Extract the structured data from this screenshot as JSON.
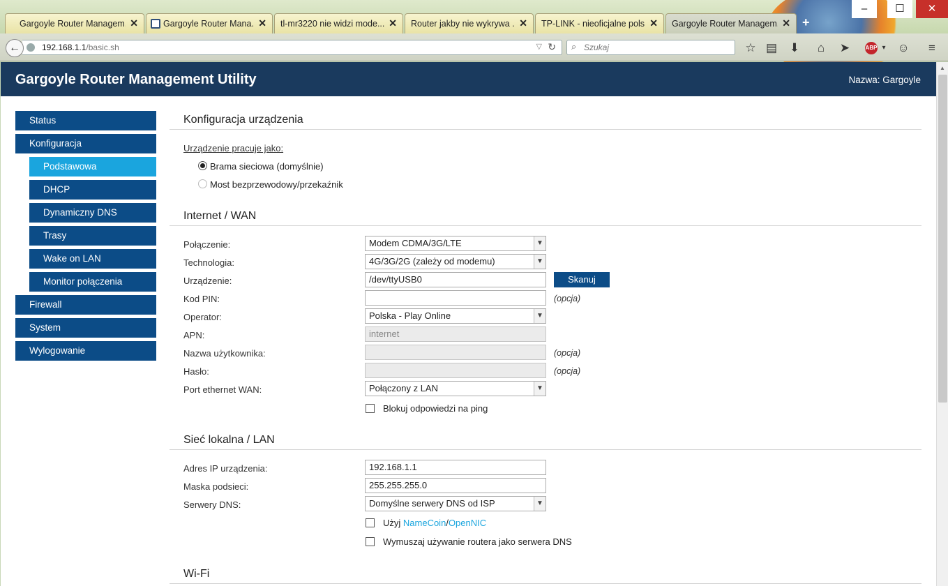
{
  "browser": {
    "tabs": [
      {
        "title": "Gargoyle Router Managem..."
      },
      {
        "title": "Gargoyle Router Mana..."
      },
      {
        "title": "tl-mr3220 nie widzi mode..."
      },
      {
        "title": "Router jakby nie wykrywa ..."
      },
      {
        "title": "TP-LINK - nieoficjalne pols..."
      },
      {
        "title": "Gargoyle Router Managem..."
      }
    ],
    "url_host": "192.168.1.1",
    "url_path": "/basic.sh",
    "search_placeholder": "Szukaj",
    "abp_label": "ABP"
  },
  "header": {
    "title": "Gargoyle Router Management Utility",
    "name_label": "Nazwa: Gargoyle"
  },
  "sidebar": {
    "items": [
      {
        "label": "Status"
      },
      {
        "label": "Konfiguracja"
      },
      {
        "label": "Podstawowa"
      },
      {
        "label": "DHCP"
      },
      {
        "label": "Dynamiczny DNS"
      },
      {
        "label": "Trasy"
      },
      {
        "label": "Wake on LAN"
      },
      {
        "label": "Monitor połączenia"
      },
      {
        "label": "Firewall"
      },
      {
        "label": "System"
      },
      {
        "label": "Wylogowanie"
      }
    ]
  },
  "device": {
    "title": "Konfiguracja urządzenia",
    "mode_label": "Urządzenie pracuje jako:",
    "option_gateway": "Brama sieciowa (domyślnie)",
    "option_bridge": "Most bezprzewodowy/przekaźnik"
  },
  "wan": {
    "title": "Internet / WAN",
    "connection_label": "Połączenie:",
    "connection_value": "Modem CDMA/3G/LTE",
    "technology_label": "Technologia:",
    "technology_value": "4G/3G/2G (zależy od modemu)",
    "device_label": "Urządzenie:",
    "device_value": "/dev/ttyUSB0",
    "scan_button": "Skanuj",
    "pin_label": "Kod PIN:",
    "pin_value": "",
    "optional": "(opcja)",
    "operator_label": "Operator:",
    "operator_value": "Polska - Play Online",
    "apn_label": "APN:",
    "apn_value": "internet",
    "username_label": "Nazwa użytkownika:",
    "username_value": "",
    "password_label": "Hasło:",
    "password_value": "",
    "port_label": "Port ethernet WAN:",
    "port_value": "Połączony z LAN",
    "block_ping_label": "Blokuj odpowiedzi na ping"
  },
  "lan": {
    "title": "Sieć lokalna / LAN",
    "ip_label": "Adres IP urządzenia:",
    "ip_value": "192.168.1.1",
    "mask_label": "Maska podsieci:",
    "mask_value": "255.255.255.0",
    "dns_label": "Serwery DNS:",
    "dns_value": "Domyślne serwery DNS od ISP",
    "use_prefix": "Użyj ",
    "namecoin_link": "NameCoin",
    "slash": "/",
    "opennic_link": "OpenNIC",
    "force_dns_label": "Wymuszaj używanie routera jako serwera DNS"
  },
  "wifi": {
    "title": "Wi-Fi"
  },
  "colors": {
    "header_bg": "#1a3a5e",
    "nav_bg": "#0c4c87",
    "nav_active": "#1aa5de",
    "link": "#1aa5de"
  }
}
